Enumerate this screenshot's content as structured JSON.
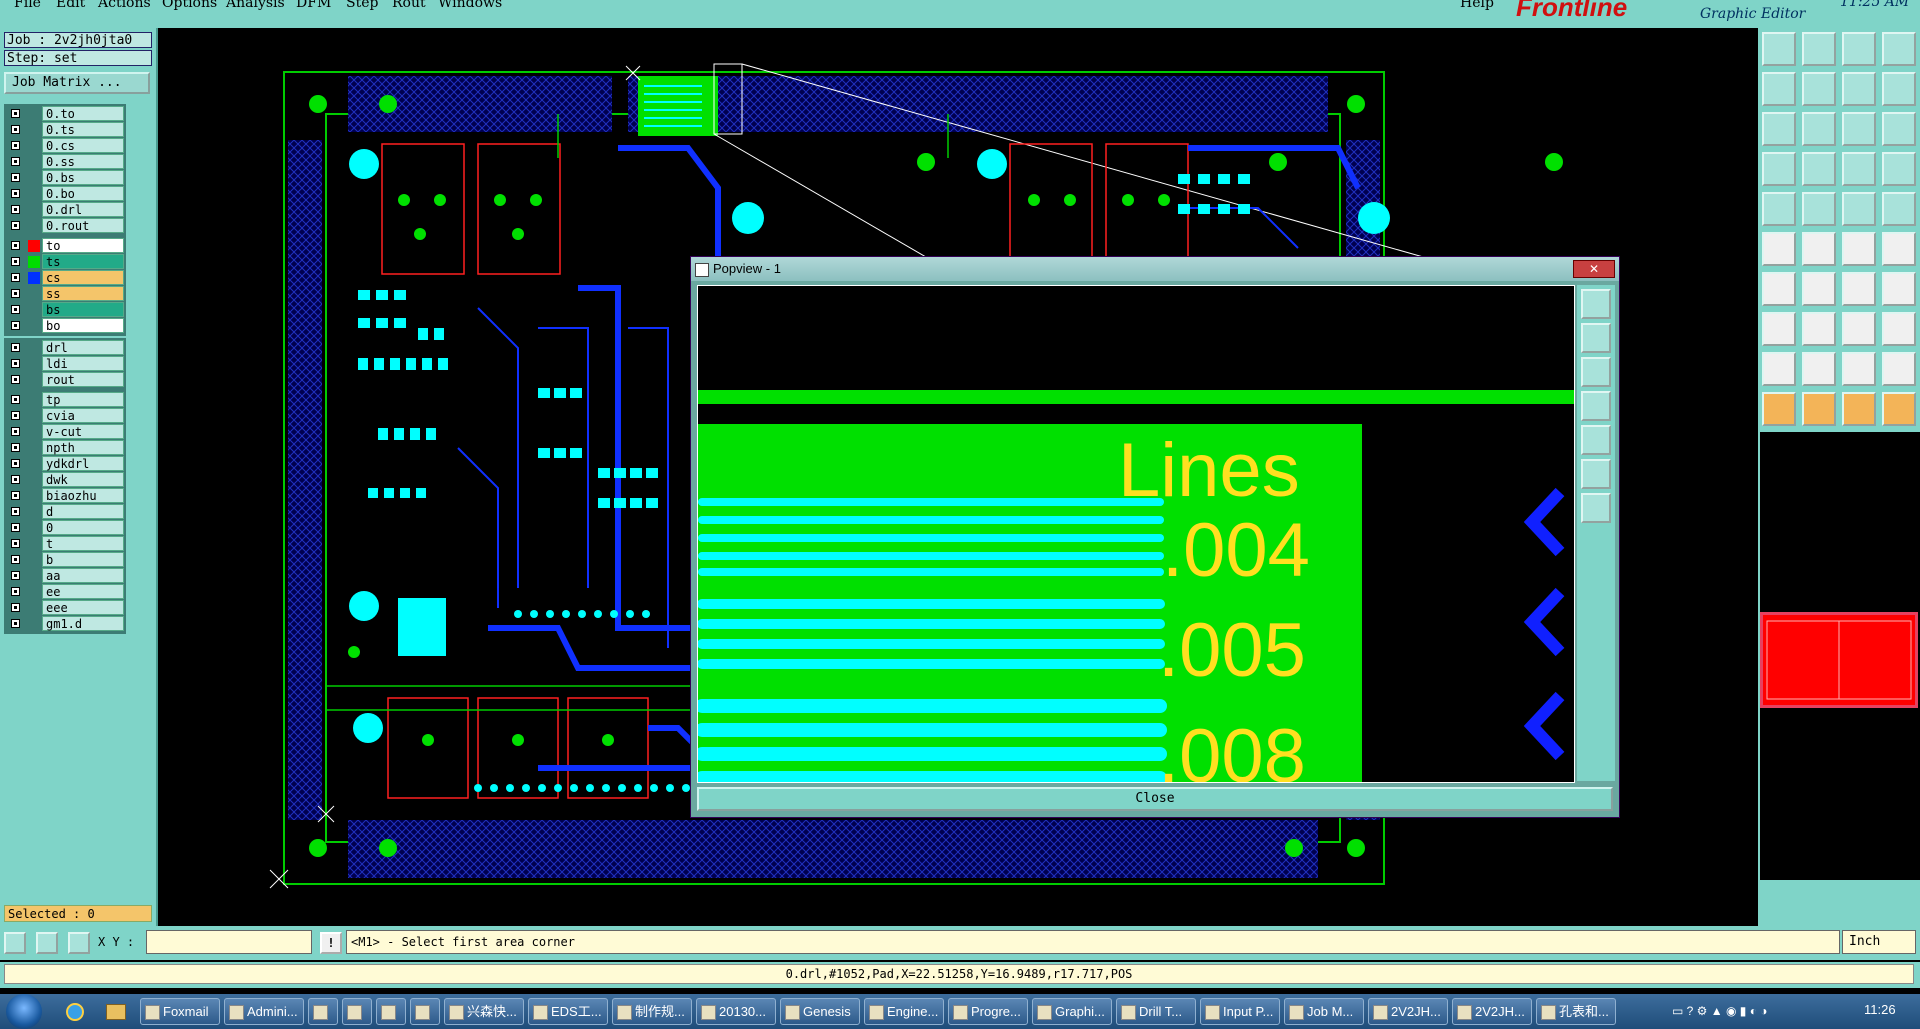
{
  "menubar": {
    "items": [
      "File",
      "Edit",
      "Actions",
      "Options",
      "Analysis",
      "DFM",
      "Step",
      "Rout",
      "Windows",
      "Help"
    ],
    "brand": "Frontline",
    "subtitle": "Graphic Editor",
    "time": "11:25 AM"
  },
  "left": {
    "job": "Job : 2v2jh0jta0",
    "step": "Step: set",
    "job_matrix": "Job Matrix ...",
    "layers_top": [
      "0.to",
      "0.ts",
      "0.cs",
      "0.ss",
      "0.bs",
      "0.bo",
      "0.drl",
      "0.rout"
    ],
    "layers_board": [
      {
        "name": "to",
        "color": "#ffffff",
        "swatch": "#ff0000"
      },
      {
        "name": "ts",
        "color": "#22aa88",
        "swatch": "#00dd00"
      },
      {
        "name": "cs",
        "color": "#f4c56a",
        "swatch": "#0030ff"
      },
      {
        "name": "ss",
        "color": "#f4c56a",
        "swatch": ""
      },
      {
        "name": "bs",
        "color": "#22aa88",
        "swatch": ""
      },
      {
        "name": "bo",
        "color": "#ffffff",
        "swatch": ""
      }
    ],
    "layers_drill": [
      "drl",
      "ldi",
      "rout"
    ],
    "layers_misc": [
      "tp",
      "cvia",
      "v-cut",
      "npth",
      "ydkdrl",
      "dwk",
      "biaozhu",
      "d",
      "0",
      "t",
      "b",
      "aa",
      "ee",
      "eee",
      "gm1.d"
    ],
    "selected": "Selected : 0"
  },
  "popview": {
    "title": "Popview - 1",
    "label_lines": "Lines",
    "label_004": ".004",
    "label_005": ".005",
    "label_008": ".008",
    "close": "Close"
  },
  "cmd": {
    "xy_label": "X Y :",
    "prompt": "<M1> - Select first area corner",
    "units": "Inch"
  },
  "status": "0.drl,#1052,Pad,X=22.51258,Y=16.9489,r17.717,POS",
  "taskbar": {
    "items": [
      "Foxmail",
      "Admini...",
      "",
      "",
      "",
      "",
      "兴森快...",
      "EDS工...",
      "制作规...",
      "20130...",
      "Genesis",
      "Engine...",
      "Progre...",
      "Graphi...",
      "Drill T...",
      "Input P...",
      "Job M...",
      "2V2JH...",
      "2V2JH...",
      "孔表和..."
    ],
    "clock": "11:26"
  },
  "colors": {
    "panel": "#7fd4c8",
    "copper_green": "#00e000",
    "pad_cyan": "#00ffff",
    "trace_blue": "#0030ff",
    "outline_red": "#ff2020",
    "label_yellow": "#ffe020"
  }
}
